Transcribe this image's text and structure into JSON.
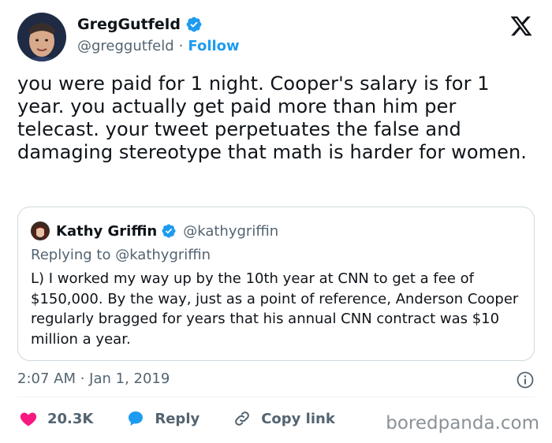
{
  "author": {
    "display_name": "GregGutfeld",
    "handle": "@greggutfeld",
    "separator": "·",
    "follow_label": "Follow"
  },
  "tweet": {
    "text": "you were paid for 1 night. Cooper's salary is for 1 year. you actually get paid more than him per telecast. your tweet perpetuates the false and damaging stereotype that math is harder for women."
  },
  "quoted": {
    "display_name": "Kathy Griffin",
    "handle": "@kathygriffin",
    "replying_to": "Replying to @kathygriffin",
    "text": "L) I worked my way up by the 10th year at CNN to get a fee of $150,000. By the way, just as a point of reference, Anderson Cooper regularly bragged for years that his annual CNN contract was $10 million a year."
  },
  "meta": {
    "timestamp": "2:07 AM · Jan 1, 2019"
  },
  "actions": {
    "likes": "20.3K",
    "reply_label": "Reply",
    "copy_link_label": "Copy link"
  },
  "watermark": "boredpanda.com",
  "colors": {
    "accent": "#1d9bf0",
    "like": "#f91880",
    "text": "#0f1419",
    "secondary": "#536471"
  }
}
